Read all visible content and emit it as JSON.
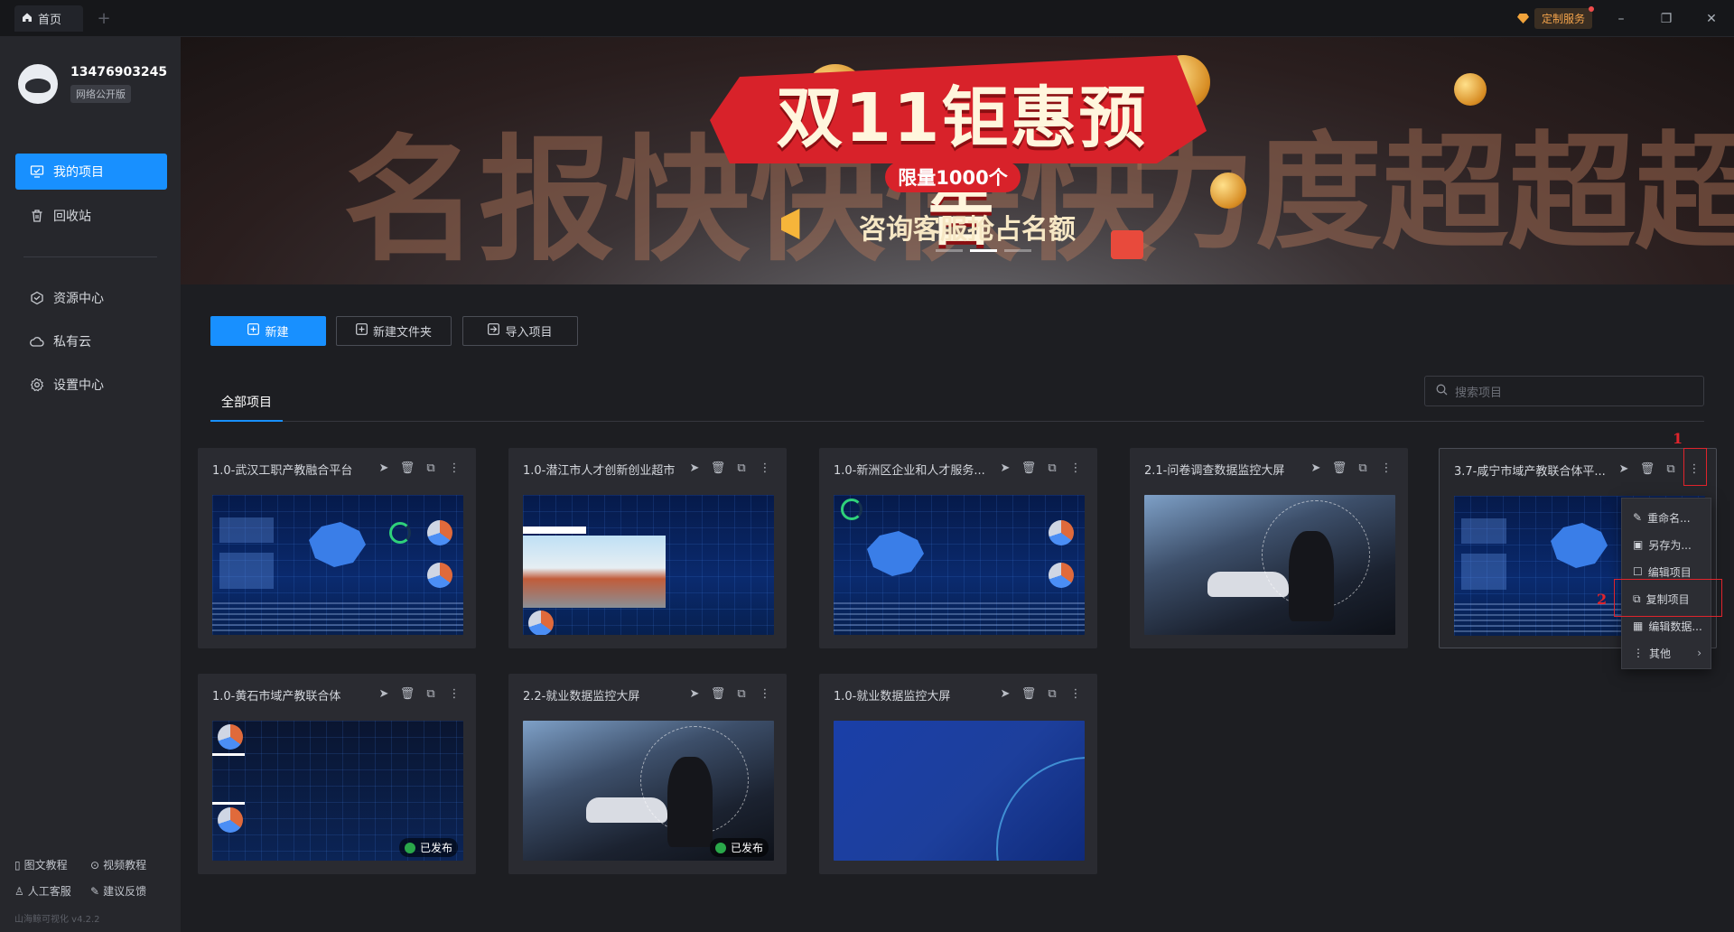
{
  "titlebar": {
    "home_tab": "首页",
    "add_tab": "+",
    "custom_service": "定制服务",
    "minimize": "–",
    "restore": "❐",
    "close": "✕"
  },
  "user": {
    "phone": "13476903245",
    "edition": "网络公开版"
  },
  "sidebar": {
    "items": [
      {
        "label": "我的项目",
        "icon": "project-icon",
        "active": true
      },
      {
        "label": "回收站",
        "icon": "trash-icon"
      },
      {
        "label": "资源中心",
        "icon": "resource-icon"
      },
      {
        "label": "私有云",
        "icon": "cloud-icon"
      },
      {
        "label": "设置中心",
        "icon": "settings-icon"
      }
    ],
    "footer_links": [
      "图文教程",
      "视频教程",
      "人工客服",
      "建议反馈"
    ],
    "version": "山海鲸可视化 v4.2.2"
  },
  "banner": {
    "headline": "双11钜惠预告",
    "pill": "限量1000个",
    "subline": "咨询客服抢占名额",
    "bg_left": "名报快快快快",
    "bg_right": "力度超超超级大"
  },
  "toolbar": {
    "new": "新建",
    "new_folder": "新建文件夹",
    "import": "导入项目"
  },
  "tabs": {
    "all": "全部项目"
  },
  "search": {
    "placeholder": "搜索项目"
  },
  "projects": [
    {
      "title": "1.0-武汉工职产教融合平台",
      "thumb": "dashboard",
      "published": false
    },
    {
      "title": "1.0-潜江市人才创新创业超市",
      "thumb": "city",
      "published": false
    },
    {
      "title": "1.0-新洲区企业和人才服务...",
      "thumb": "dashboard",
      "published": false
    },
    {
      "title": "2.1-问卷调查数据监控大屏",
      "thumb": "photo",
      "published": false
    },
    {
      "title": "3.7-咸宁市域产教联合体平...",
      "thumb": "dashboard",
      "published": false
    },
    {
      "title": "1.0-黄石市域产教联合体",
      "thumb": "dashboard-dark",
      "published": true
    },
    {
      "title": "2.2-就业数据监控大屏",
      "thumb": "photo",
      "published": true
    },
    {
      "title": "1.0-就业数据监控大屏",
      "thumb": "blue",
      "published": false
    }
  ],
  "published_label": "已发布",
  "context_menu": {
    "items": [
      "重命名...",
      "另存为...",
      "编辑项目",
      "复制项目",
      "编辑数据...",
      "其他"
    ],
    "submenu_chevron": "›"
  },
  "annotations": {
    "marker1": "1",
    "marker2": "2"
  },
  "colors": {
    "accent": "#1890ff",
    "highlight": "#e0242c",
    "published": "#2aa84a"
  }
}
